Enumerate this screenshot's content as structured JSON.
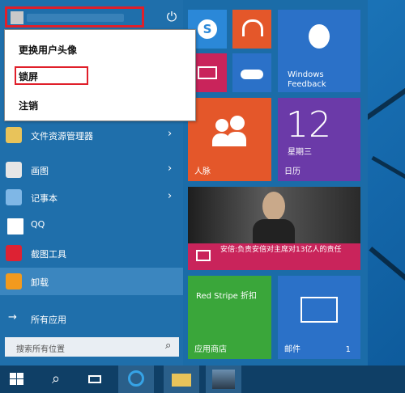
{
  "user": {
    "avatar_icon": "user-icon",
    "power_icon": "power-icon"
  },
  "account_menu": {
    "items": [
      {
        "label": "更换用户头像"
      },
      {
        "label": "锁屏"
      },
      {
        "label": "注销"
      }
    ]
  },
  "apps": [
    {
      "label": "文件资源管理器",
      "icon": "folder-icon",
      "chevron": "›"
    },
    {
      "label": "画图",
      "icon": "paint-icon",
      "chevron": "›"
    },
    {
      "label": "记事本",
      "icon": "notepad-icon",
      "chevron": "›"
    },
    {
      "label": "QQ",
      "icon": "qq-icon"
    },
    {
      "label": "截图工具",
      "icon": "snipping-tool-icon"
    },
    {
      "label": "卸载",
      "icon": "uninstall-icon"
    }
  ],
  "all_apps": {
    "label": "所有应用",
    "arrow": "→"
  },
  "search": {
    "placeholder": "搜索所有位置",
    "icon": "search-icon"
  },
  "tiles": {
    "windows_feedback": {
      "label": "Windows\nFeedback"
    },
    "people": {
      "label": "人脉"
    },
    "calendar": {
      "day": "12",
      "weekday": "星期三",
      "label": "日历"
    },
    "news": {
      "headline": "安倍:负责安倍对主席对13亿人的责任"
    },
    "store": {
      "title": "Red Stripe 折扣",
      "label": "应用商店"
    },
    "mail": {
      "label": "邮件",
      "count": "1"
    }
  },
  "colors": {
    "accent_red": "#e01f2a",
    "tile_orange": "#e4572a",
    "tile_purple": "#6b3aa8",
    "tile_blue": "#2b71c8",
    "tile_green": "#3aa63a"
  }
}
